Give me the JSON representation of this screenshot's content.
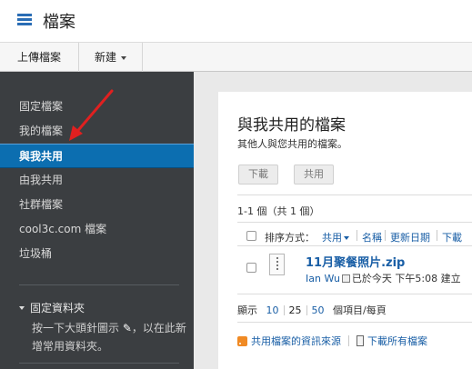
{
  "app": {
    "title": "檔案"
  },
  "toolbar": {
    "upload_label": "上傳檔案",
    "new_label": "新建"
  },
  "sidebar": {
    "items": [
      {
        "label": "固定檔案"
      },
      {
        "label": "我的檔案"
      },
      {
        "label": "與我共用"
      },
      {
        "label": "由我共用"
      },
      {
        "label": "社群檔案"
      },
      {
        "label": "cool3c.com 檔案"
      },
      {
        "label": "垃圾桶"
      }
    ],
    "active_index": 2,
    "pinned": {
      "heading": "固定資料夾",
      "desc_before": "按一下大頭針圖示",
      "desc_after": "，以在此新增常用資料夾。"
    }
  },
  "main": {
    "title": "與我共用的檔案",
    "subtitle": "其他人與您共用的檔案。",
    "buttons": {
      "download": "下載",
      "share": "共用"
    },
    "count": "1-1 個（共 1 個）",
    "sort": {
      "label": "排序方式：",
      "options": [
        "共用",
        "名稱",
        "更新日期",
        "下載"
      ]
    },
    "file": {
      "name": "11月聚餐照片.zip",
      "owner": "Ian Wu",
      "meta": "已於今天 下午5:08 建立"
    },
    "pager": {
      "label": "顯示",
      "sizes": [
        "10",
        "25",
        "50"
      ],
      "suffix": "個項目/每頁"
    },
    "links": {
      "rss": "共用檔案的資訊來源",
      "download_all": "下載所有檔案"
    }
  },
  "colors": {
    "accent": "#0c6eb0",
    "sidebar_bg": "#3b3e41",
    "link": "#1a5fa6",
    "annotation_arrow": "#e02020"
  },
  "icons": [
    "files-logo-icon",
    "chevron-down-icon",
    "pin-icon",
    "zip-file-icon",
    "rss-icon",
    "download-icon",
    "checkbox-icon"
  ]
}
